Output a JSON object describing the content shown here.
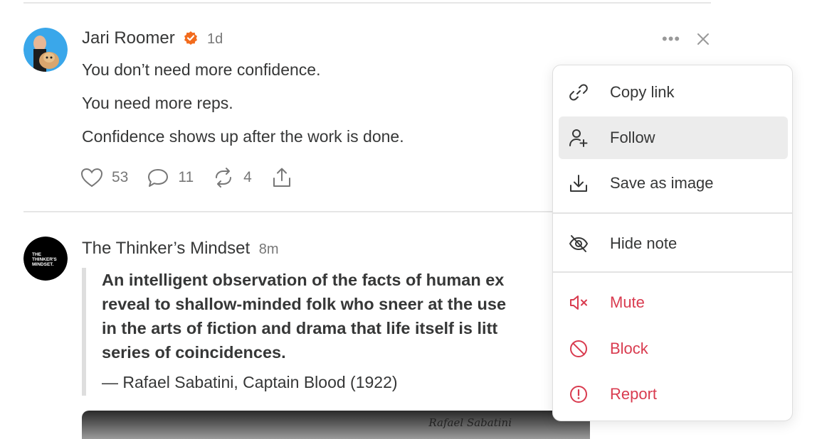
{
  "post1": {
    "author": "Jari Roomer",
    "time": "1d",
    "lines": [
      "You don’t need more confidence.",
      "You need more reps.",
      "Confidence shows up after the work is done."
    ],
    "likes": "53",
    "comments": "11",
    "restacks": "4"
  },
  "post2": {
    "author": "The Thinker’s Mindset",
    "time": "8m",
    "avatar_text": [
      "THE",
      "THINKER'S",
      "MINDSET."
    ],
    "quote_lines": [
      "An intelligent observation of the facts of human ex",
      "reveal to shallow-minded folk who sneer at the use",
      "in the arts of fiction and drama that life itself is litt",
      "series of coincidences."
    ],
    "attribution": "— Rafael Sabatini, Captain Blood (1922)",
    "image_signature": "Rafael Sabatini"
  },
  "menu": {
    "copy_link": "Copy link",
    "follow": "Follow",
    "save_as_image": "Save as image",
    "hide_note": "Hide note",
    "mute": "Mute",
    "block": "Block",
    "report": "Report"
  },
  "colors": {
    "accent_orange": "#f26b1d",
    "danger_red": "#d93b4f",
    "text": "#363737",
    "muted": "#777777"
  }
}
